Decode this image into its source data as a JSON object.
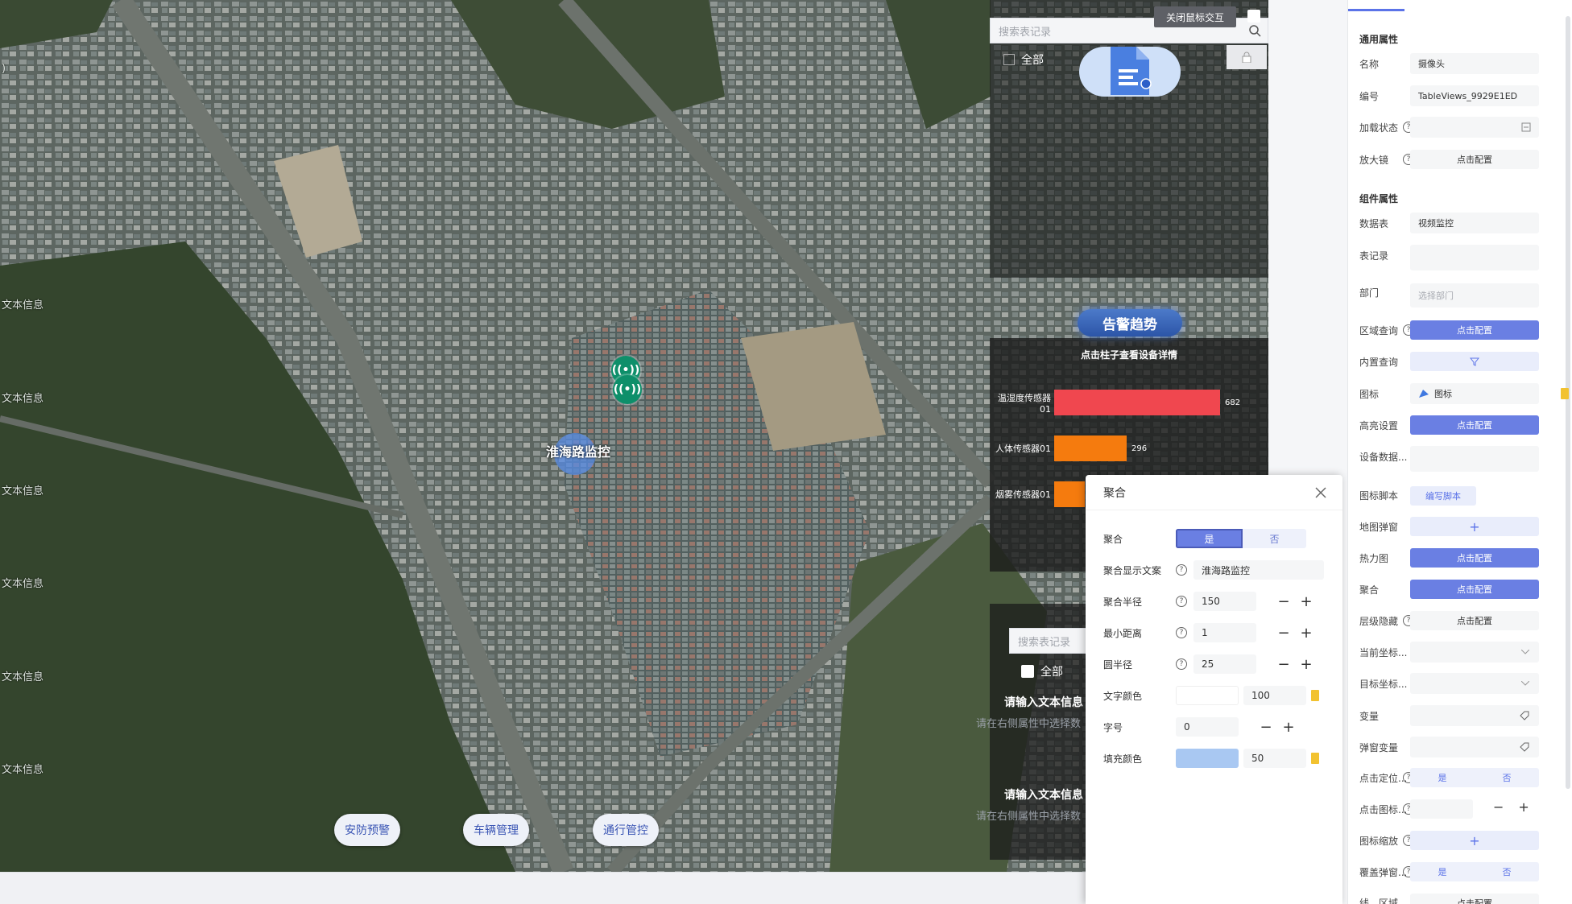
{
  "map": {
    "text_labels": [
      "文本信息",
      "文本信息",
      "文本信息",
      "文本信息",
      "文本信息",
      "文本信息"
    ],
    "marker_glyph": "((•))",
    "cluster_label": "淮海路监控",
    "nav_buttons": [
      "安防预警",
      "车辆管理",
      "通行管控"
    ],
    "tiny_label": ")"
  },
  "overlay": {
    "search_placeholder": "搜索表记录",
    "close_mouse_label": "关闭鼠标交互",
    "all_label": "全部",
    "alarm_title": "告警趋势",
    "alarm_subtitle": "点击柱子查看设备详情",
    "bars": [
      {
        "name": "温湿度传感器01",
        "value": 682,
        "color": "#f0474f"
      },
      {
        "name": "人体传感器01",
        "value": 296,
        "color": "#f57b0e"
      },
      {
        "name": "烟雾传感器01",
        "value": 120,
        "color": "#f57b0e"
      }
    ],
    "search2_placeholder": "搜索表记录",
    "all2_label": "全部",
    "text_title": "请输入文本信息",
    "text_sub": "请在右侧属性中选择数",
    "text_title2": "请输入文本信息",
    "text_sub2": "请在右侧属性中选择数"
  },
  "popup": {
    "title": "聚合",
    "rows": {
      "cluster": {
        "label": "聚合",
        "yes": "是",
        "no": "否"
      },
      "display_text": {
        "label": "聚合显示文案",
        "value": "淮海路监控"
      },
      "radius": {
        "label": "聚合半径",
        "value": "150"
      },
      "min_distance": {
        "label": "最小距离",
        "value": "1"
      },
      "circle_radius": {
        "label": "圆半径",
        "value": "25"
      },
      "text_color": {
        "label": "文字颜色",
        "value": "100"
      },
      "font_size": {
        "label": "字号",
        "value": "0"
      },
      "fill_color": {
        "label": "填充颜色",
        "value": "50",
        "swatch": "#a9c8f2"
      }
    },
    "minus": "−",
    "plus": "+"
  },
  "props": {
    "general_title": "通用属性",
    "component_title": "组件属性",
    "name_label": "名称",
    "name_value": "摄像头",
    "id_label": "编号",
    "id_value": "TableViews_9929E1ED",
    "load_label": "加载状态",
    "magnifier_label": "放大镜",
    "config": "点击配置",
    "datatable_label": "数据表",
    "datatable_value": "视频监控",
    "record_label": "表记录",
    "dept_label": "部门",
    "dept_placeholder": "选择部门",
    "area_label": "区域查询",
    "builtin_label": "内置查询",
    "icon_label": "图标",
    "icon_value": "图标",
    "highlight_label": "高亮设置",
    "devdata_label": "设备数据...",
    "iconscript_label": "图标脚本",
    "iconscript_btn": "编写脚本",
    "mappopup_label": "地图弹窗",
    "heatmap_label": "热力图",
    "cluster_label": "聚合",
    "layerhide_label": "层级隐藏",
    "curcoord_label": "当前坐标...",
    "targetcoord_label": "目标坐标...",
    "var_label": "变量",
    "popupvar_label": "弹窗变量",
    "clickloc_label": "点击定位...",
    "clickicon_label": "点击图标...",
    "iconzoom_label": "图标缩放",
    "coverpopup_label": "覆盖弹窗...",
    "line_label": "线、区域",
    "yes": "是",
    "no": "否",
    "plus": "+",
    "minus": "−"
  }
}
